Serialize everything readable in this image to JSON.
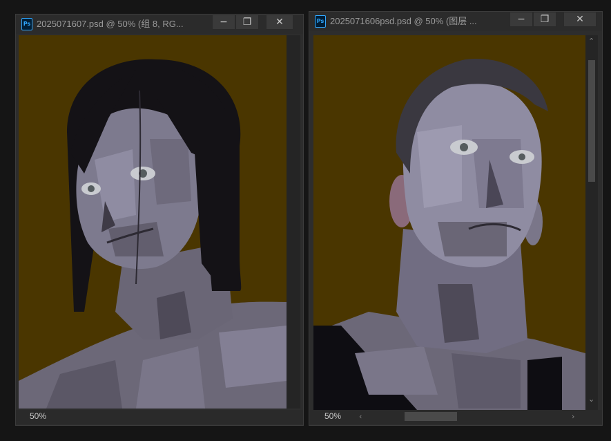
{
  "windows": [
    {
      "title": "2025071607.psd @ 50% (组 8, RG...",
      "zoom": "50%",
      "icon_label": "Ps",
      "buttons": {
        "minimize": "−",
        "restore": "❐",
        "close": "✕"
      }
    },
    {
      "title": "2025071606psd.psd @ 50% (图层 ...",
      "zoom": "50%",
      "icon_label": "Ps",
      "buttons": {
        "minimize": "−",
        "restore": "❐",
        "close": "✕"
      },
      "scroll_arrows": {
        "up": "⌃",
        "down": "⌄",
        "left": "‹",
        "right": "›"
      }
    }
  ],
  "colors": {
    "canvas_background": "#4a3600",
    "skin_mid": "#6c6878",
    "skin_light": "#8f8ca2",
    "hair": "#141216"
  }
}
